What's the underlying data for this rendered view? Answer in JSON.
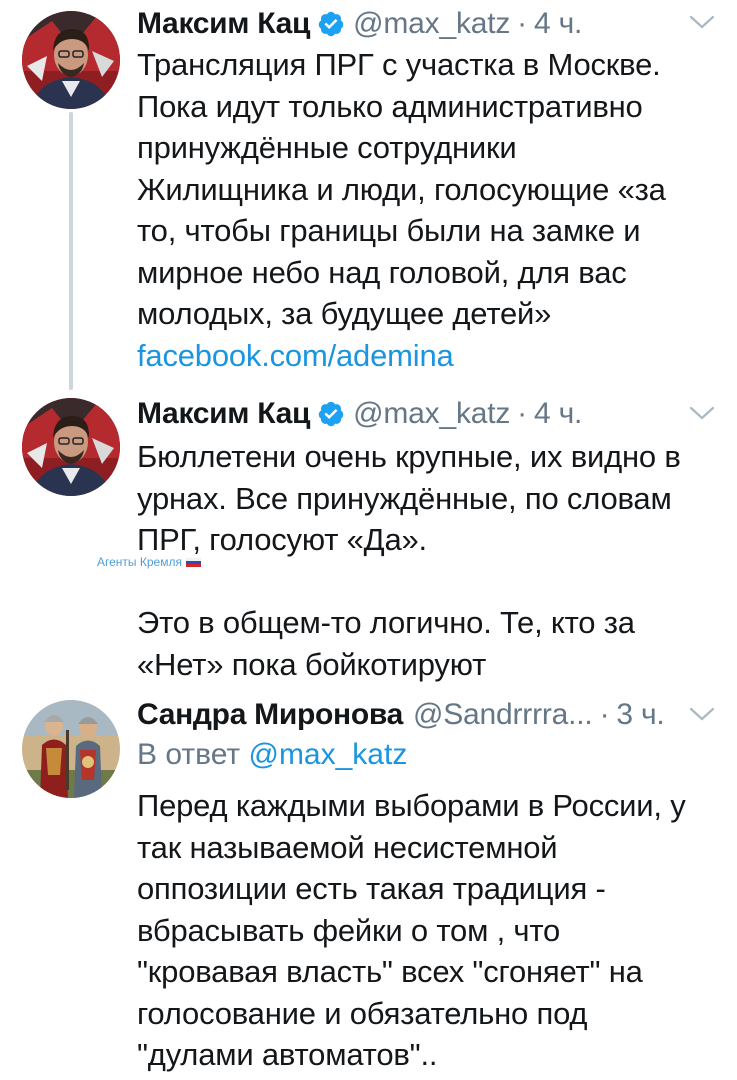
{
  "tweets": [
    {
      "author_name": "Максим Кац",
      "handle": "@max_katz",
      "dot": "·",
      "time": "4 ч.",
      "verified": true,
      "lines": [
        "Трансляция ПРГ с участка в Москве.",
        "Пока идут только административно",
        "принуждённые сотрудники",
        "Жилищника и люди, голосующие «за",
        "то, чтобы границы были на замке и",
        "мирное небо над головой, для вас",
        "молодых, за будущее детей»"
      ],
      "link": "facebook.com/ademina"
    },
    {
      "author_name": "Максим Кац",
      "handle": "@max_katz",
      "dot": "·",
      "time": "4 ч.",
      "verified": true,
      "lines": [
        "Бюллетени очень крупные, их видно в",
        "урнах. Все принуждённые, по словам",
        "ПРГ, голосуют «Да».",
        "",
        "Это в общем-то логично. Те, кто за",
        "«Нет» пока бойкотируют"
      ]
    },
    {
      "author_name": "Сандра Миронова",
      "handle": "@Sandrrrra...",
      "dot": "·",
      "time": "3 ч.",
      "verified": false,
      "reply_prefix": "В ответ",
      "reply_handle": "@max_katz",
      "lines": [
        "Перед каждыми выборами в России, у",
        "так называемой несистемной",
        "оппозиции есть такая традиция -",
        "вбрасывать фейки о том , что",
        "\"кровавая власть\" всех \"сгоняет\" на",
        "голосование и обязательно под",
        "\"дулами автоматов\".."
      ]
    }
  ],
  "watermark": {
    "text": "Агенты Кремля"
  },
  "colors": {
    "text": "#14171a",
    "secondary": "#657786",
    "link": "#1b95e0",
    "verified": "#1da1f2",
    "thread_line": "#ccd6dd"
  },
  "icons": {
    "verified": "verified-badge-icon",
    "more": "chevron-down-icon",
    "flag": "russian-flag-icon"
  }
}
